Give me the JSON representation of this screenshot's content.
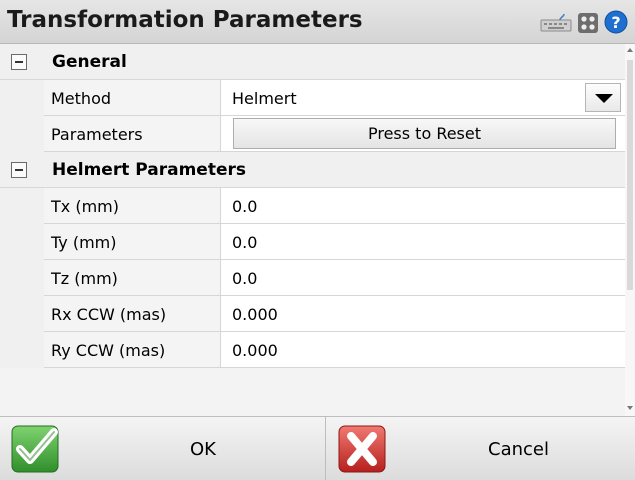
{
  "title": "Transformation Parameters",
  "title_icons": [
    "keyboard-icon",
    "grid-icon",
    "help-icon"
  ],
  "general": {
    "label": "General",
    "method": {
      "name": "Method",
      "value": "Helmert"
    },
    "parameters": {
      "name": "Parameters",
      "button_label": "Press to Reset"
    }
  },
  "helmert": {
    "label": "Helmert Parameters",
    "rows": [
      {
        "name": "Tx (mm)",
        "value": "0.0"
      },
      {
        "name": "Ty (mm)",
        "value": "0.0"
      },
      {
        "name": "Tz (mm)",
        "value": "0.0"
      },
      {
        "name": "Rx CCW (mas)",
        "value": "0.000"
      },
      {
        "name": "Ry CCW (mas)",
        "value": "0.000"
      }
    ]
  },
  "footer": {
    "ok_label": "OK",
    "cancel_label": "Cancel"
  },
  "colors": {
    "ok_green": "#3ea83a",
    "cancel_red": "#d7312f",
    "help_blue": "#1f6fd1"
  }
}
